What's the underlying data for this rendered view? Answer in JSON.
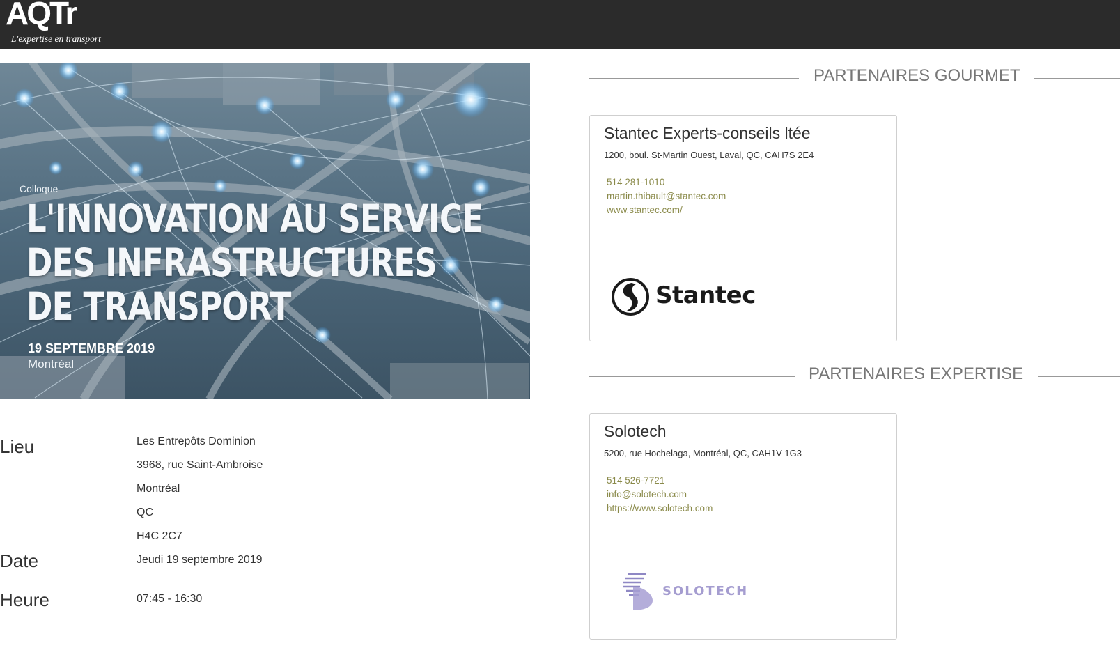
{
  "header": {
    "logo_text": "AQTr",
    "logo_tagline": "L'expertise en transport"
  },
  "event": {
    "banner": {
      "kicker": "Colloque",
      "title_lines": [
        "L'INNOVATION AU SERVICE",
        "DES INFRASTRUCTURES",
        "DE TRANSPORT"
      ],
      "date": "19 SEPTEMBRE 2019",
      "city": "Montréal"
    },
    "location_label": "Lieu",
    "location_lines": [
      "Les Entrepôts Dominion",
      "3968, rue Saint-Ambroise",
      "Montréal",
      "QC",
      "H4C 2C7"
    ],
    "date_label": "Date",
    "date_value": "Jeudi 19 septembre 2019",
    "time_label": "Heure",
    "time_value": "07:45 - 16:30"
  },
  "sections": [
    {
      "title": "PARTENAIRES GOURMET",
      "partner": {
        "name": "Stantec Experts-conseils ltée",
        "address": "1200, boul. St-Martin Ouest, Laval, QC, CAH7S 2E4",
        "phone": "514 281-1010",
        "email": "martin.thibault@stantec.com",
        "website": "www.stantec.com/",
        "logo_text": "Stantec"
      }
    },
    {
      "title": "PARTENAIRES EXPERTISE",
      "partner": {
        "name": "Solotech",
        "address": "5200, rue Hochelaga, Montréal, QC, CAH1V 1G3",
        "phone": "514 526-7721",
        "email": "info@solotech.com",
        "website": "https://www.solotech.com",
        "logo_text": "SOLOTECH"
      }
    }
  ],
  "colors": {
    "header_bg": "#2b2b2b",
    "link": "#8a8a4a",
    "section_title": "#777777",
    "solotech_purple": "#9b8fc9",
    "solotech_pink": "#e89bb5"
  }
}
